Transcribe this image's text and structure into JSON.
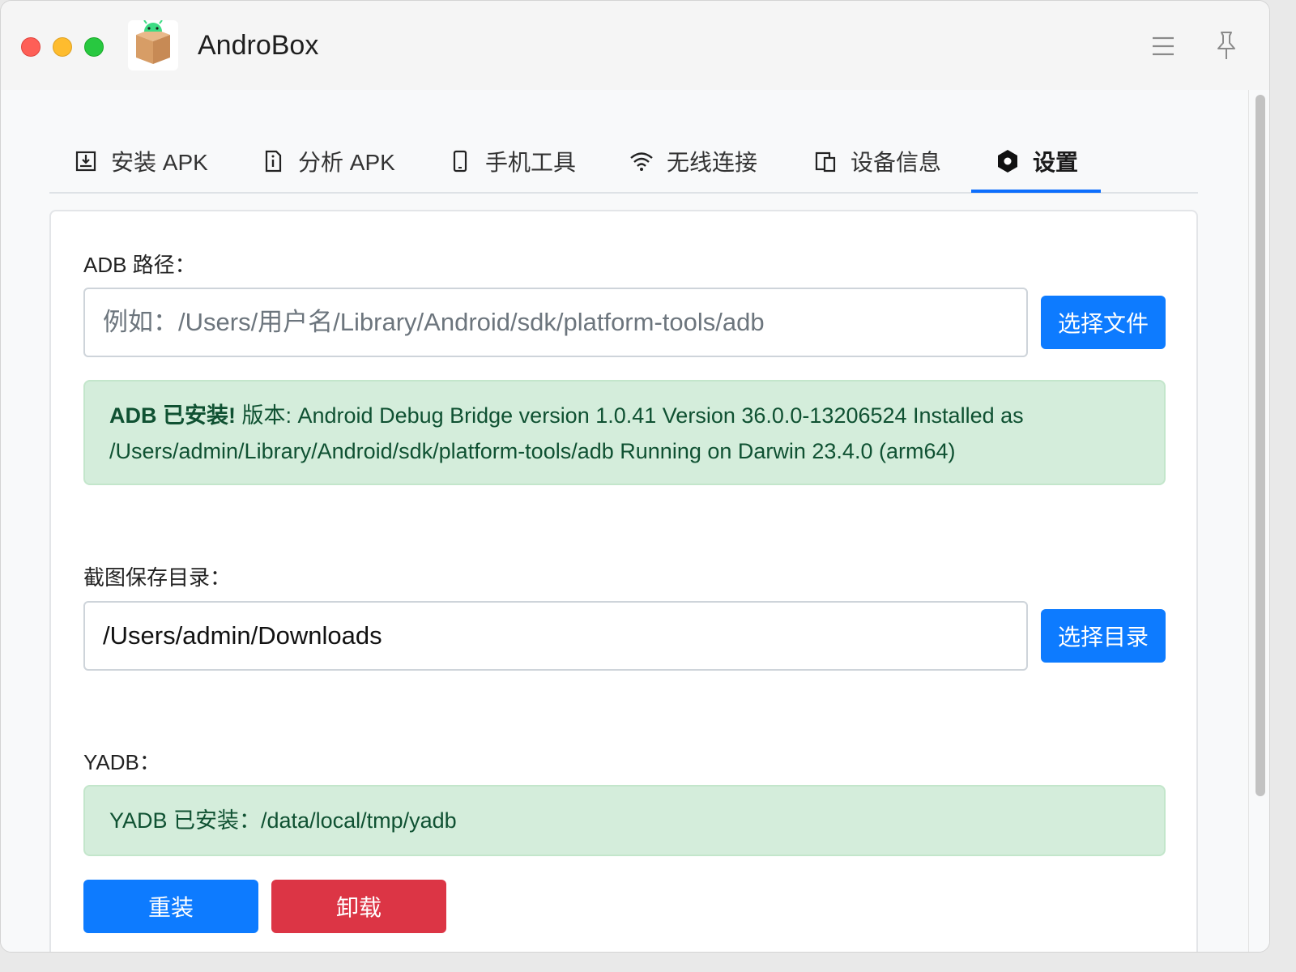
{
  "app": {
    "title": "AndroBox"
  },
  "titlebar": {
    "menu_icon": "hamburger-menu-icon",
    "pin_icon": "pin-icon"
  },
  "tabs": [
    {
      "label": "安装 APK",
      "icon": "install-icon",
      "active": false
    },
    {
      "label": "分析 APK",
      "icon": "file-info-icon",
      "active": false
    },
    {
      "label": "手机工具",
      "icon": "phone-icon",
      "active": false
    },
    {
      "label": "无线连接",
      "icon": "wifi-icon",
      "active": false
    },
    {
      "label": "设备信息",
      "icon": "devices-icon",
      "active": false
    },
    {
      "label": "设置",
      "icon": "settings-hex-icon",
      "active": true
    }
  ],
  "settings": {
    "adb": {
      "label": "ADB 路径：",
      "value": "",
      "placeholder": "例如：/Users/用户名/Library/Android/sdk/platform-tools/adb",
      "button": "选择文件",
      "status_strong": "ADB 已安装!",
      "status_text": " 版本: Android Debug Bridge version 1.0.41 Version 36.0.0-13206524 Installed as /Users/admin/Library/Android/sdk/platform-tools/adb Running on Darwin 23.4.0 (arm64)"
    },
    "screenshot": {
      "label": "截图保存目录：",
      "value": "/Users/admin/Downloads",
      "button": "选择目录"
    },
    "yadb": {
      "label": "YADB：",
      "status": "YADB 已安装：/data/local/tmp/yadb",
      "reinstall_button": "重装",
      "uninstall_button": "卸载"
    }
  },
  "colors": {
    "primary": "#0d7bff",
    "danger": "#dc3545",
    "success_bg": "#d4eddb",
    "success_text": "#0f5132",
    "tab_active_underline": "#0d6efd"
  }
}
